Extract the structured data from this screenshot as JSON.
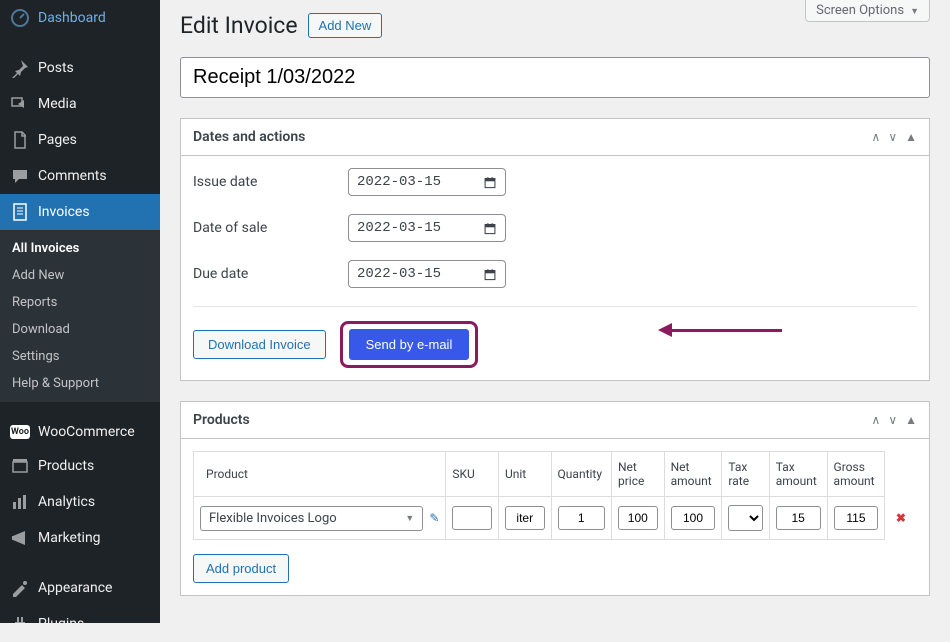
{
  "screen_options_label": "Screen Options",
  "page_title": "Edit Invoice",
  "add_new_label": "Add New",
  "title_input_value": "Receipt 1/03/2022",
  "sidebar": [
    {
      "label": "Dashboard",
      "icon": "dashboard"
    },
    {
      "label": "Posts",
      "icon": "pin"
    },
    {
      "label": "Media",
      "icon": "media"
    },
    {
      "label": "Pages",
      "icon": "page"
    },
    {
      "label": "Comments",
      "icon": "comment"
    },
    {
      "label": "Invoices",
      "icon": "invoice",
      "active": true
    },
    {
      "label": "WooCommerce",
      "icon": "woo"
    },
    {
      "label": "Products",
      "icon": "products"
    },
    {
      "label": "Analytics",
      "icon": "analytics"
    },
    {
      "label": "Marketing",
      "icon": "marketing"
    },
    {
      "label": "Appearance",
      "icon": "appearance"
    },
    {
      "label": "Plugins",
      "icon": "plugin"
    }
  ],
  "submenu": [
    {
      "label": "All Invoices",
      "current": true
    },
    {
      "label": "Add New"
    },
    {
      "label": "Reports"
    },
    {
      "label": "Download"
    },
    {
      "label": "Settings"
    },
    {
      "label": "Help & Support"
    }
  ],
  "dates_panel": {
    "title": "Dates and actions",
    "issue_label": "Issue date",
    "issue_value": "2022-03-15",
    "sale_label": "Date of sale",
    "sale_value": "2022-03-15",
    "due_label": "Due date",
    "due_value": "2022-03-15",
    "download_label": "Download Invoice",
    "send_label": "Send by e-mail"
  },
  "products_panel": {
    "title": "Products",
    "headers": {
      "product": "Product",
      "sku": "SKU",
      "unit": "Unit",
      "qty": "Quantity",
      "net_price": "Net price",
      "net_amount": "Net amount",
      "tax_rate": "Tax rate",
      "tax_amount": "Tax amount",
      "gross_amount": "Gross amount"
    },
    "row": {
      "product": "Flexible Invoices Logo",
      "sku": "",
      "unit": "iter",
      "qty": "1",
      "net_price": "100",
      "net_amount": "100",
      "tax_rate": "",
      "tax_amount": "15",
      "gross_amount": "115"
    },
    "add_product_label": "Add product"
  }
}
